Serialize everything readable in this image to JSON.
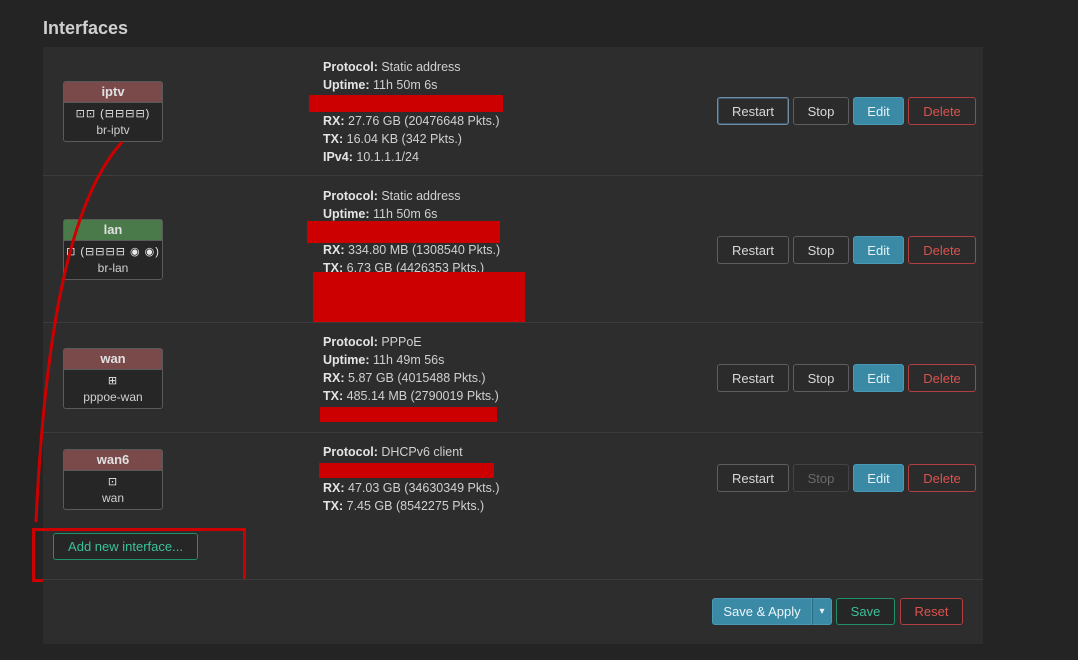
{
  "section_title": "Interfaces",
  "colors": {
    "iptv_header": "#7a4a4a",
    "lan_header": "#4a7a4a",
    "wan_header": "#7a4a4a",
    "wan6_header": "#7a4a4a",
    "edit_button": "#3a8aa6",
    "delete_text": "#d9534f",
    "add_text": "#3cc199",
    "annotation": "#cc0000"
  },
  "interfaces": [
    {
      "name": "iptv",
      "icons": "⊡⊡ (⊟⊟⊟⊟)",
      "device": "br-iptv",
      "protocol_label": "Protocol:",
      "protocol": "Static address",
      "uptime_label": "Uptime:",
      "uptime": "11h 50m 6s",
      "rx_label": "RX:",
      "rx": "27.76 GB (20476648 Pkts.)",
      "tx_label": "TX:",
      "tx": "16.04 KB (342 Pkts.)",
      "ipv4_label": "IPv4:",
      "ipv4": "10.1.1.1/24"
    },
    {
      "name": "lan",
      "icons": "⊡ (⊟⊟⊟⊟ ◉ ◉)",
      "device": "br-lan",
      "protocol_label": "Protocol:",
      "protocol": "Static address",
      "uptime_label": "Uptime:",
      "uptime": "11h 50m 6s",
      "rx_label": "RX:",
      "rx": "334.80 MB (1308540 Pkts.)",
      "tx_label": "TX:",
      "tx": "6.73 GB (4426353 Pkts.)"
    },
    {
      "name": "wan",
      "icons": "⊞",
      "device": "pppoe-wan",
      "protocol_label": "Protocol:",
      "protocol": "PPPoE",
      "uptime_label": "Uptime:",
      "uptime": "11h 49m 56s",
      "rx_label": "RX:",
      "rx": "5.87 GB (4015488 Pkts.)",
      "tx_label": "TX:",
      "tx": "485.14 MB (2790019 Pkts.)"
    },
    {
      "name": "wan6",
      "icons": "⊡",
      "device": "wan",
      "protocol_label": "Protocol:",
      "protocol": "DHCPv6 client",
      "rx_label": "RX:",
      "rx": "47.03 GB (34630349 Pkts.)",
      "tx_label": "TX:",
      "tx": "7.45 GB (8542275 Pkts.)"
    }
  ],
  "row_actions": {
    "restart": "Restart",
    "stop": "Stop",
    "edit": "Edit",
    "delete": "Delete"
  },
  "add_interface": "Add new interface...",
  "footer": {
    "save_apply": "Save & Apply",
    "dropdown": "▾",
    "save": "Save",
    "reset": "Reset"
  }
}
